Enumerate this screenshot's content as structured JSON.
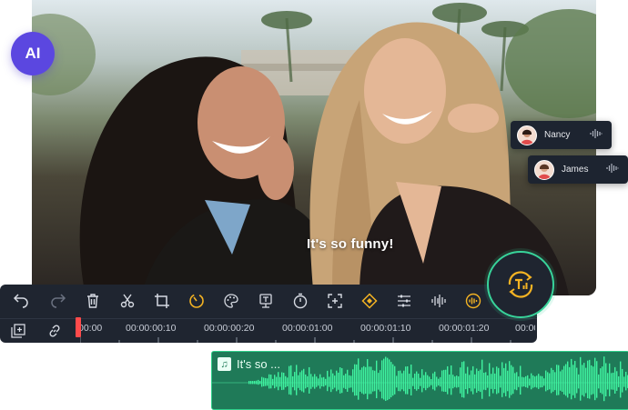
{
  "badge": {
    "label": "AI"
  },
  "video": {
    "subtitle": "It's so funny!"
  },
  "speakers": [
    {
      "name": "Nancy"
    },
    {
      "name": "James"
    }
  ],
  "toolbar": {
    "tools": [
      "undo-icon",
      "redo-icon",
      "delete-icon",
      "cut-icon",
      "crop-icon",
      "speed-icon",
      "color-icon",
      "text-to-speech-icon",
      "timer-icon",
      "fit-icon",
      "keyframe-icon",
      "adjust-icon",
      "audio-split-icon",
      "voice-icon"
    ]
  },
  "timeline": {
    "labels": [
      "00:00",
      "00:00:00:10",
      "00:00:00:20",
      "00:00:01:00",
      "00:00:01:10",
      "00:00:01:20",
      "00:00:0"
    ]
  },
  "audio_clip": {
    "title": "It's so ..."
  },
  "colors": {
    "panel": "#1f2530",
    "accent_green": "#38d39a",
    "accent_yellow": "#f4b323",
    "badge_purple": "#5b47e0",
    "playhead": "#ff4b4b",
    "waveform": "#3ff2a0"
  }
}
